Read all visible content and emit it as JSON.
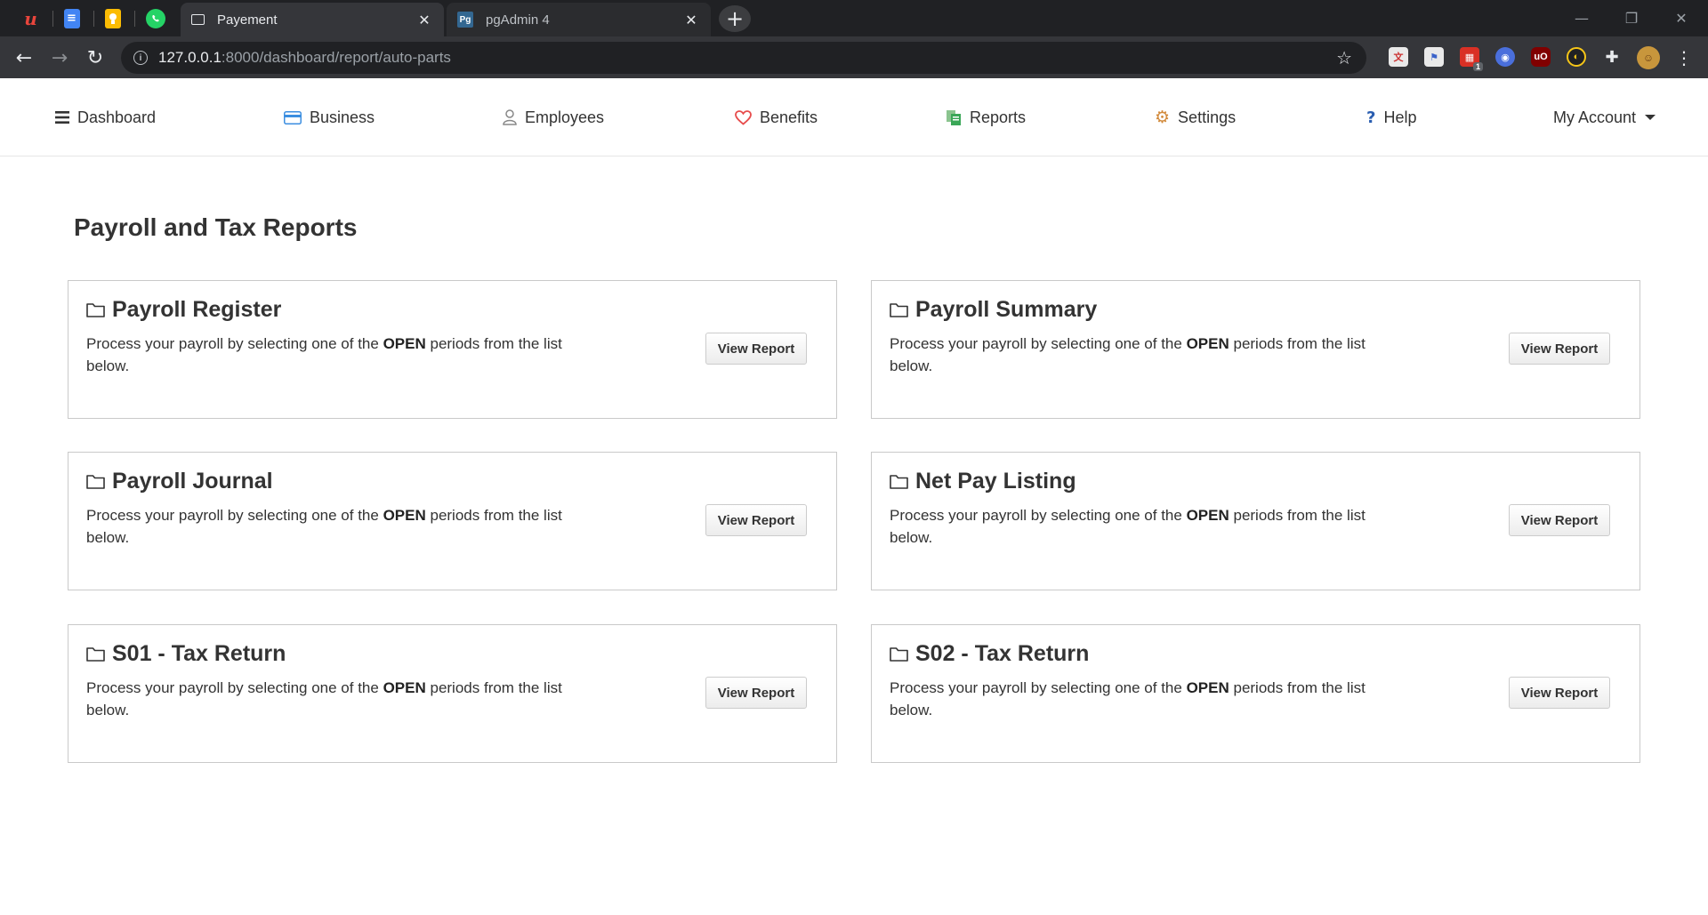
{
  "browser": {
    "pinned_tabs": [
      {
        "name": "pinned-tab-app",
        "icon": "red-u-icon",
        "color": "#e8453c",
        "glyph": "u"
      },
      {
        "name": "pinned-tab-docs",
        "icon": "google-docs-icon",
        "color": "#4285f4",
        "glyph": "≡"
      },
      {
        "name": "pinned-tab-keep",
        "icon": "google-keep-icon",
        "color": "#fbbc04",
        "glyph": "💡"
      },
      {
        "name": "pinned-tab-whatsapp",
        "icon": "whatsapp-icon",
        "color": "#25d366",
        "glyph": "✆"
      }
    ],
    "tabs": [
      {
        "title": "Payement",
        "active": true,
        "icon": "page-icon"
      },
      {
        "title": "pgAdmin 4",
        "active": false,
        "icon": "pgadmin-icon",
        "fav_text": "Pg"
      }
    ],
    "new_tab_glyph": "+",
    "url_host": "127.0.0.1",
    "url_rest": ":8000/dashboard/report/auto-parts",
    "extension_badge": "1"
  },
  "nav": {
    "items": [
      {
        "label": "Dashboard",
        "icon": "hamburger-icon"
      },
      {
        "label": "Business",
        "icon": "credit-card-icon"
      },
      {
        "label": "Employees",
        "icon": "user-icon"
      },
      {
        "label": "Benefits",
        "icon": "heart-icon"
      },
      {
        "label": "Reports",
        "icon": "reports-icon"
      },
      {
        "label": "Settings",
        "icon": "gear-icon"
      },
      {
        "label": "Help",
        "icon": "question-icon"
      }
    ],
    "account_label": "My Account"
  },
  "page": {
    "title": "Payroll and Tax Reports"
  },
  "reports": [
    {
      "title": "Payroll Register",
      "desc_pre": "Process your payroll by selecting one of the ",
      "desc_bold": "OPEN",
      "desc_post": " periods from the list below.",
      "button": "View Report"
    },
    {
      "title": "Payroll Summary",
      "desc_pre": "Process your payroll by selecting one of the ",
      "desc_bold": "OPEN",
      "desc_post": " periods from the list below.",
      "button": "View Report"
    },
    {
      "title": "Payroll Journal",
      "desc_pre": "Process your payroll by selecting one of the ",
      "desc_bold": "OPEN",
      "desc_post": " periods from the list below.",
      "button": "View Report"
    },
    {
      "title": "Net Pay Listing",
      "desc_pre": "Process your payroll by selecting one of the ",
      "desc_bold": "OPEN",
      "desc_post": " periods from the list below.",
      "button": "View Report"
    },
    {
      "title": "S01 - Tax Return",
      "desc_pre": "Process your payroll by selecting one of the ",
      "desc_bold": "OPEN",
      "desc_post": " periods from the list below.",
      "button": "View Report"
    },
    {
      "title": "S02 - Tax Return",
      "desc_pre": "Process your payroll by selecting one of the ",
      "desc_bold": "OPEN",
      "desc_post": " periods from the list below.",
      "button": "View Report"
    }
  ],
  "colors": {
    "benefits_heart": "#e74c4c",
    "business_card": "#3b8ee0",
    "reports_icon": "#3aa757",
    "settings_gear": "#d28a3b",
    "help_icon": "#2a5db0"
  }
}
